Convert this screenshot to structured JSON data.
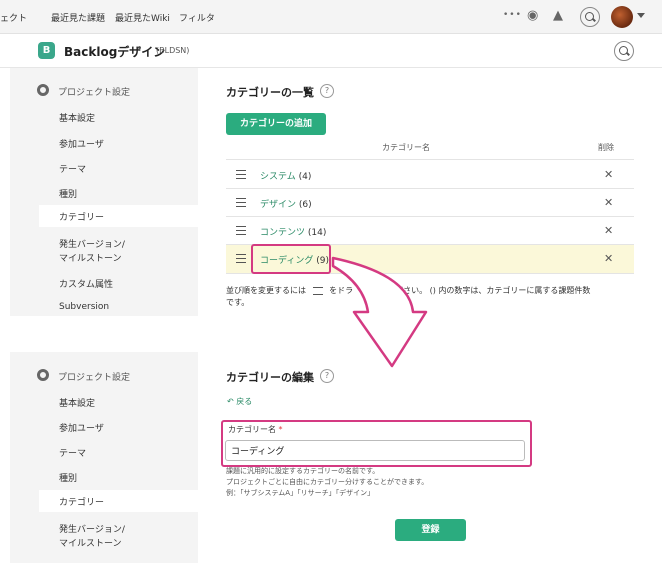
{
  "topnav": {
    "items": [
      "ェクト",
      "最近見た課題",
      "最近見たWiki",
      "フィルタ"
    ],
    "more": "•••"
  },
  "project": {
    "logo": "B",
    "name": "Backlogデザイン",
    "key": "(BLDSN)"
  },
  "sidebar_top": {
    "heading": "プロジェクト設定",
    "items": [
      "基本設定",
      "参加ユーザ",
      "テーマ",
      "種別",
      "カテゴリー",
      "発生バージョン/",
      "マイルストーン",
      "カスタム属性",
      "Subversion"
    ]
  },
  "sidebar_bottom": {
    "heading": "プロジェクト設定",
    "items": [
      "基本設定",
      "参加ユーザ",
      "テーマ",
      "種別",
      "カテゴリー",
      "発生バージョン/",
      "マイルストーン"
    ]
  },
  "list_section": {
    "title": "カテゴリーの一覧",
    "help": "?",
    "add_button": "カテゴリーの追加",
    "col_name": "カテゴリー名",
    "col_delete": "削除",
    "rows": [
      {
        "name": "システム",
        "count": "(4)"
      },
      {
        "name": "デザイン",
        "count": "(6)"
      },
      {
        "name": "コンテンツ",
        "count": "(14)"
      },
      {
        "name": "コーディング",
        "count": "(9)"
      }
    ],
    "delete_glyph": "✕",
    "note_line1": "並び順を変更するには",
    "note_line1b": "をドラ",
    "note_line1c": "ください。 () 内の数字は、カテゴリーに属する課題件数",
    "note_line2": "です。"
  },
  "edit_section": {
    "title": "カテゴリーの編集",
    "help": "?",
    "back": "戻る",
    "field_label": "カテゴリー名",
    "required_mark": "*",
    "field_value": "コーディング",
    "hint1": "課題に汎用的に設定するカテゴリーの名前です。",
    "hint2": "プロジェクトごとに自由にカテゴリー分けすることができます。",
    "hint3": "例：「サブシステムA」「リサーチ」「デザイン」",
    "submit": "登録"
  },
  "colors": {
    "accent": "#2bac7f",
    "highlight_box": "#d43a82",
    "selected_row": "#fbf8d9"
  }
}
